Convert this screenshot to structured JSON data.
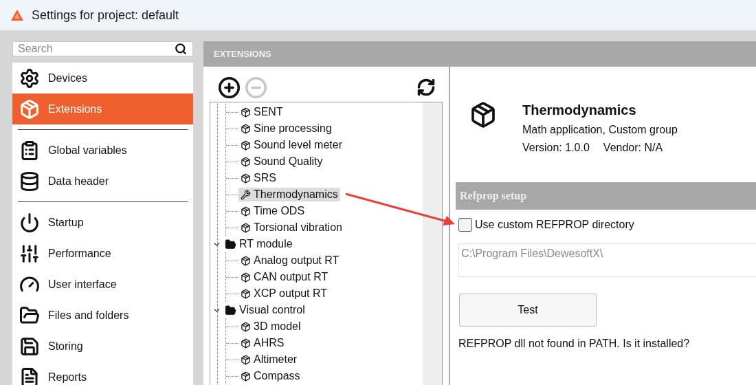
{
  "window": {
    "title": "Settings for project: default"
  },
  "search": {
    "placeholder": "Search"
  },
  "sidebar": {
    "groups": [
      [
        {
          "label": "Devices",
          "selected": false
        },
        {
          "label": "Extensions",
          "selected": true
        }
      ],
      [
        {
          "label": "Global variables",
          "selected": false
        },
        {
          "label": "Data header",
          "selected": false
        }
      ],
      [
        {
          "label": "Startup",
          "selected": false
        },
        {
          "label": "Performance",
          "selected": false
        },
        {
          "label": "User interface",
          "selected": false
        },
        {
          "label": "Files and folders",
          "selected": false
        },
        {
          "label": "Storing",
          "selected": false
        },
        {
          "label": "Reports",
          "selected": false
        }
      ]
    ]
  },
  "extensions_panel": {
    "title": "EXTENSIONS",
    "add_enabled": true,
    "remove_enabled": false,
    "tree": {
      "scrolled_group_children": [
        {
          "label": "SENT",
          "kind": "extension",
          "selected": false
        },
        {
          "label": "Sine processing",
          "kind": "extension",
          "selected": false
        },
        {
          "label": "Sound level meter",
          "kind": "extension",
          "selected": false
        },
        {
          "label": "Sound Quality",
          "kind": "extension",
          "selected": false
        },
        {
          "label": "SRS",
          "kind": "extension",
          "selected": false
        },
        {
          "label": "Thermodynamics",
          "kind": "tool",
          "selected": true
        },
        {
          "label": "Time ODS",
          "kind": "extension",
          "selected": false
        },
        {
          "label": "Torsional vibration",
          "kind": "extension",
          "selected": false
        }
      ],
      "groups": [
        {
          "label": "RT module",
          "expanded": true,
          "children": [
            {
              "label": "Analog output RT",
              "kind": "extension",
              "selected": false
            },
            {
              "label": "CAN output RT",
              "kind": "extension",
              "selected": false
            },
            {
              "label": "XCP output RT",
              "kind": "extension",
              "selected": false
            }
          ]
        },
        {
          "label": "Visual control",
          "expanded": true,
          "children": [
            {
              "label": "3D model",
              "kind": "extension",
              "selected": false
            },
            {
              "label": "AHRS",
              "kind": "extension",
              "selected": false
            },
            {
              "label": "Altimeter",
              "kind": "extension",
              "selected": false
            },
            {
              "label": "Compass",
              "kind": "extension",
              "selected": false
            }
          ]
        }
      ]
    }
  },
  "details": {
    "name": "Thermodynamics",
    "category": "Math application, Custom group",
    "version": "Version: 1.0.0",
    "vendor": "Vendor: N/A",
    "section": {
      "title": "Refprop setup",
      "custom_directory": {
        "label": "Use custom REFPROP directory",
        "checked": false
      },
      "path_field": {
        "value": "C:\\Program Files\\DewesoftX\\",
        "disabled": true
      },
      "test_button": "Test",
      "message": "REFPROP dll not found in PATH. Is it installed?"
    }
  }
}
